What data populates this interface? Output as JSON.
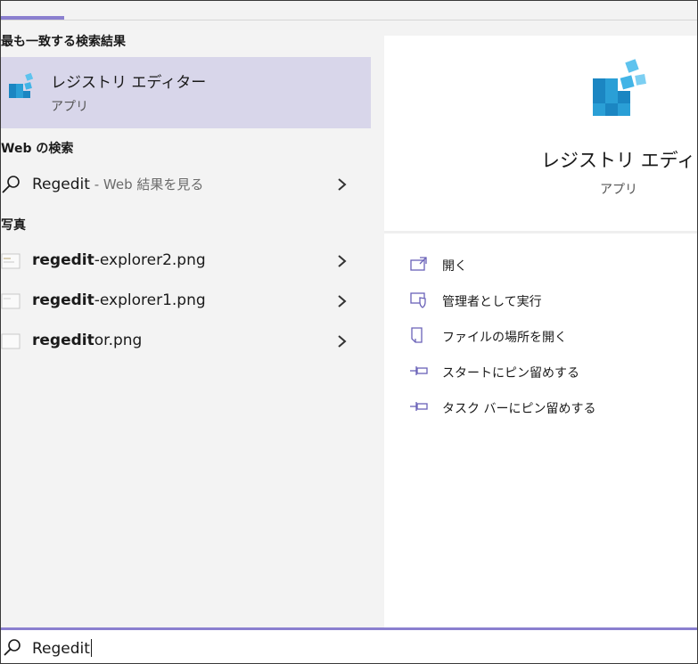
{
  "colors": {
    "accent": "#8a7fcf",
    "selected_bg": "#d8d6ea",
    "icon_blue": "#2a9fd6"
  },
  "left": {
    "best_match_header": "最も一致する検索結果",
    "best_match": {
      "title": "レジストリ エディター",
      "subtitle": "アプリ",
      "icon": "registry-editor-icon"
    },
    "web_header": "Web の検索",
    "web_result": {
      "query": "Regedit",
      "suffix": " - Web 結果を見る"
    },
    "photos_header": "写真",
    "photos": [
      {
        "bold": "regedit",
        "rest": "-explorer2.png"
      },
      {
        "bold": "regedit",
        "rest": "-explorer1.png"
      },
      {
        "bold": "regedit",
        "rest": "or.png"
      }
    ]
  },
  "right": {
    "title": "レジストリ エディター",
    "subtitle": "アプリ",
    "actions": [
      {
        "label": "開く",
        "icon": "open-icon"
      },
      {
        "label": "管理者として実行",
        "icon": "shield-icon"
      },
      {
        "label": "ファイルの場所を開く",
        "icon": "file-location-icon"
      },
      {
        "label": "スタートにピン留めする",
        "icon": "pin-icon"
      },
      {
        "label": "タスク バーにピン留めする",
        "icon": "pin-icon"
      }
    ]
  },
  "search": {
    "value": "Regedit",
    "icon": "search-icon"
  }
}
